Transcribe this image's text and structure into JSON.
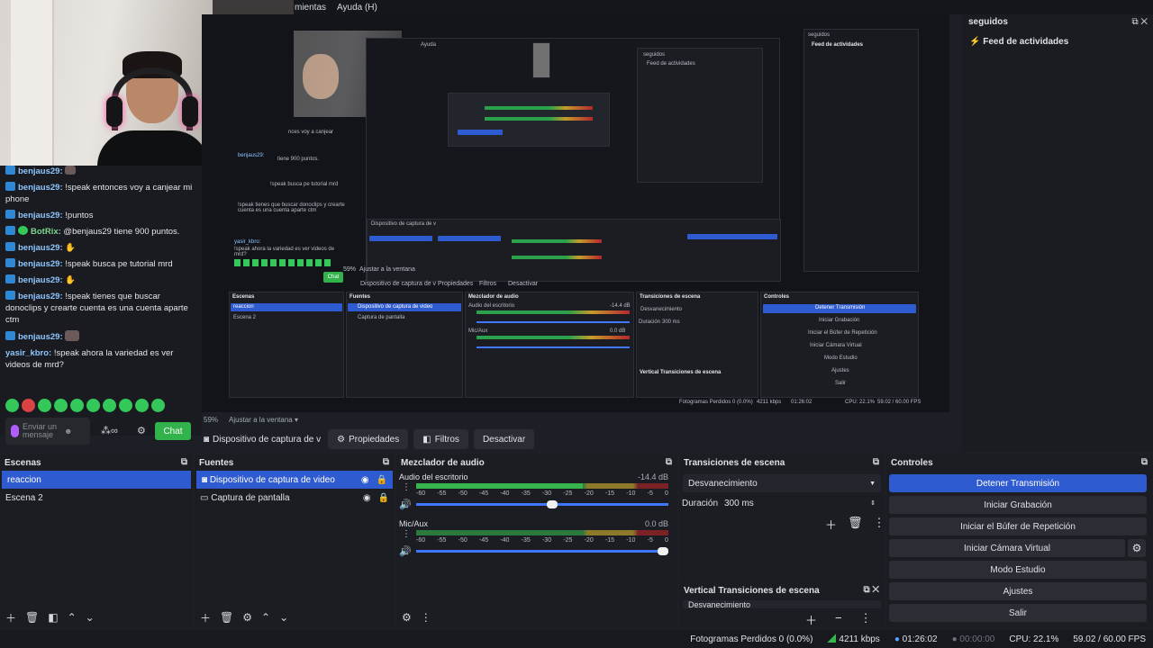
{
  "menu": [
    "mientas",
    "Ayuda (H)"
  ],
  "chat": {
    "messages": [
      {
        "user": "benjaus29:",
        "text": "",
        "emote": true
      },
      {
        "user": "benjaus29:",
        "text": "!speak entonces voy a canjear mi phone"
      },
      {
        "user": "benjaus29:",
        "text": "!puntos"
      },
      {
        "user": "BotRix:",
        "text": "@benjaus29 tiene 900 puntos.",
        "bot": true
      },
      {
        "user": "benjaus29:",
        "text": "",
        "emote": true
      },
      {
        "user": "benjaus29:",
        "text": "!speak busca pe tutorial mrd"
      },
      {
        "user": "benjaus29:",
        "text": "",
        "emote": true
      },
      {
        "user": "benjaus29:",
        "text": "!speak tienes que buscar donoclips y crearte cuenta es una cuenta aparte ctm"
      },
      {
        "user": "benjaus29:",
        "text": "",
        "emote": true
      },
      {
        "user": "yasir_kbro:",
        "text": "!speak ahora la variedad es ver videos de mrd?",
        "plain": true
      }
    ],
    "input_placeholder": "Enviar un mensaje",
    "chat_button": "Chat",
    "points": "∞"
  },
  "right_pane": {
    "title": "seguidos",
    "feed": "Feed de actividades"
  },
  "zoom": {
    "percent": "59%",
    "fit": "Ajustar a la ventana"
  },
  "source_toolbar": {
    "source": "Dispositivo de captura de v",
    "properties": "Propiedades",
    "filters": "Filtros",
    "deactivate": "Desactivar"
  },
  "scenes": {
    "title": "Escenas",
    "items": [
      "reaccion",
      "Escena 2"
    ]
  },
  "sources": {
    "title": "Fuentes",
    "items": [
      "Dispositivo de captura de video",
      "Captura de pantalla"
    ]
  },
  "mixer": {
    "title": "Mezclador de audio",
    "channels": [
      {
        "name": "Audio del escritorio",
        "db": "-14.4 dB",
        "level": 0.66,
        "volume": 0.56
      },
      {
        "name": "Mic/Aux",
        "db": "0.0 dB",
        "level": 0.0,
        "volume": 1.0
      }
    ],
    "ticks": [
      "-60",
      "-55",
      "-50",
      "-45",
      "-40",
      "-35",
      "-30",
      "-25",
      "-20",
      "-15",
      "-10",
      "-5",
      "0"
    ]
  },
  "transitions": {
    "title": "Transiciones de escena",
    "selected": "Desvanecimiento",
    "duration_label": "Duración",
    "duration": "300 ms"
  },
  "vertical_transitions": {
    "title": "Vertical Transiciones de escena",
    "selected": "Desvanecimiento"
  },
  "controls": {
    "title": "Controles",
    "buttons": [
      "Detener Transmisión",
      "Iniciar Grabación",
      "Iniciar el Búfer de Repetición",
      "Iniciar Cámara Virtual",
      "Modo Estudio",
      "Ajustes",
      "Salir"
    ]
  },
  "status": {
    "dropped": "Fotogramas Perdidos 0 (0.0%)",
    "kbps": "4211 kbps",
    "stream_time": "01:26:02",
    "rec_time": "00:00:00",
    "cpu": "CPU: 22.1%",
    "fps": "59.02 / 60.00 FPS"
  },
  "nested": {
    "menu_help": "Ayuda",
    "panel_scenes": "Escenas",
    "panel_sources": "Fuentes",
    "panel_mixer": "Mezclador de audio",
    "panel_transitions": "Transiciones de escena",
    "panel_controls": "Controles",
    "scene1": "reaccion",
    "scene2": "Escena 2",
    "src1": "Dispositivo de captura de video",
    "src2": "Captura de pantalla",
    "desktop": "Audio del escritorio",
    "mic": "Mic/Aux",
    "fade": "Desvanecimiento",
    "duration": "Duración",
    "duration_value": "300 ms",
    "btn1": "Detener Transmisión",
    "btn2": "Iniciar Grabación",
    "btn3": "Iniciar el Búfer de Repetición",
    "btn4": "Iniciar Cámara Virtual",
    "btn5": "Modo Estudio",
    "btn6": "Ajustes",
    "btn7": "Salir",
    "vertical": "Vertical Transiciones de escena",
    "seguidos": "seguidos",
    "feed": "Feed de actividades",
    "props": "Propiedades",
    "filters": "Filtros",
    "deact": "Desactivar",
    "srcdev": "Dispositivo de captura de v",
    "zoom": "59%",
    "fit": "Ajustar a la ventana",
    "status": "Fotogramas Perdidos 0 (0.0%)",
    "chat1": "benjaus29:",
    "chat_text1": "!speak busca pe tutorial mrd",
    "chat_text2": "!speak tienes que buscar donoclips y crearte cuenta es una cuenta aparte ctm",
    "chat_text3": "!speak ahora la variedad es ver videos de mrd?",
    "chat_user2": "yasir_kbro:",
    "chat_text4": "tiene 900 puntos.",
    "chat_text5": "nces voy a canjear",
    "db1": "-14.4 dB",
    "db2": "0.0 dB",
    "kbps": "4211 kbps",
    "time": "01:26:02",
    "cpu": "CPU: 22.1%",
    "fps": "59.02 / 60.00 FPS",
    "chat_btn": "Chat",
    "send": "Enviar un mensaje"
  },
  "colors": {
    "accent": "#2f5bd0",
    "chat_green": "#31b24a",
    "meter_green": "#38b44c"
  }
}
